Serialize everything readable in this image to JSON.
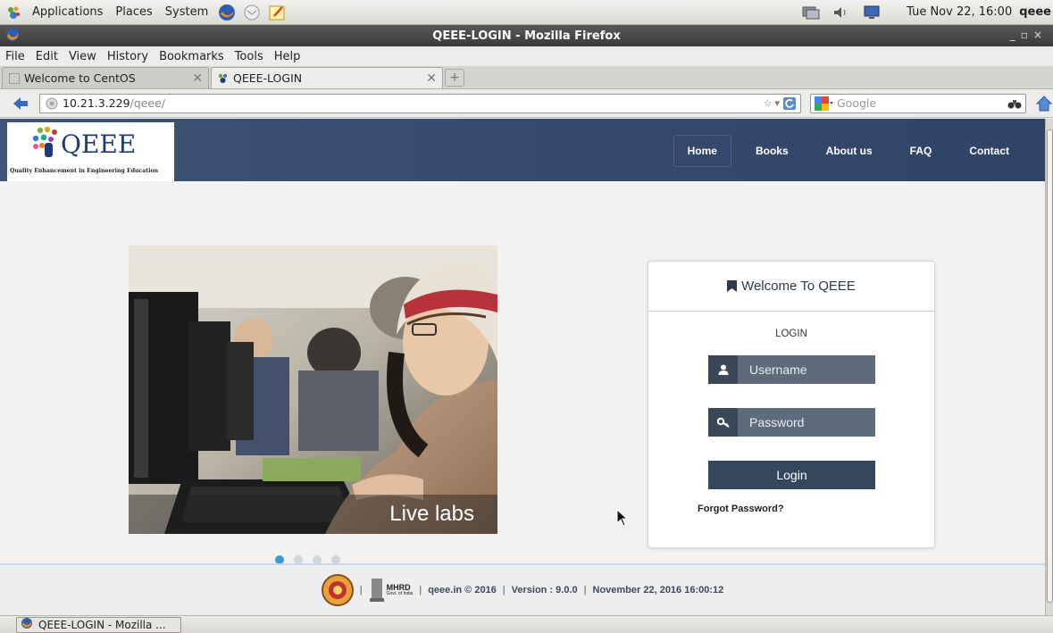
{
  "panel": {
    "menus": [
      "Applications",
      "Places",
      "System"
    ],
    "clock": "Tue Nov 22, 16:00",
    "user": "qeee"
  },
  "window": {
    "title": "QEEE-LOGIN - Mozilla Firefox"
  },
  "menubar": [
    "File",
    "Edit",
    "View",
    "History",
    "Bookmarks",
    "Tools",
    "Help"
  ],
  "tabs": [
    {
      "label": "Welcome to CentOS"
    },
    {
      "label": "QEEE-LOGIN"
    }
  ],
  "navbar": {
    "url_host": "10.21.3.229",
    "url_path": "/qeee/",
    "search_placeholder": "Google"
  },
  "site": {
    "logo": "QEEE",
    "tagline": "Quality Enhancement in Engineering Education",
    "nav": [
      "Home",
      "Books",
      "About us",
      "FAQ",
      "Contact"
    ],
    "active_nav": "Home",
    "hero_caption": "Live labs",
    "carousel_active": 1,
    "carousel_count": 4
  },
  "login": {
    "card_title": "Welcome To QEEE",
    "heading": "LOGIN",
    "username_placeholder": "Username",
    "password_placeholder": "Password",
    "button": "Login",
    "forgot": "Forgot Password?"
  },
  "footer": {
    "mhrd_label": "MHRD",
    "mhrd_sub": "Govt. of India",
    "site": "qeee.in © 2016",
    "version": "Version : 9.0.0",
    "timestamp": "November 22, 2016 16:00:12"
  },
  "taskbar": {
    "item": "QEEE-LOGIN - Mozilla ..."
  },
  "colors": {
    "header_blue": "#3e5478",
    "field_dark": "#3a4757",
    "field_bg": "#5d6b7a",
    "button_bg": "#34475c",
    "dot_active": "#3d9bd6"
  }
}
